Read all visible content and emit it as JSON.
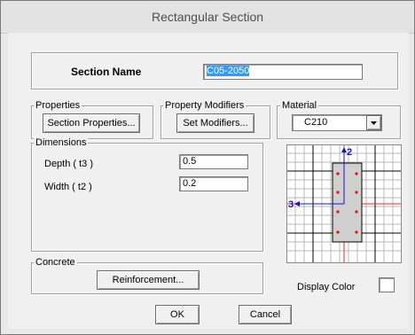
{
  "window": {
    "title": "Rectangular Section"
  },
  "section_name": {
    "label": "Section Name",
    "value": "C05-2050"
  },
  "properties": {
    "group_label": "Properties",
    "button_label": "Section Properties..."
  },
  "modifiers": {
    "group_label": "Property Modifiers",
    "button_label": "Set Modifiers..."
  },
  "material": {
    "group_label": "Material",
    "selected": "C210"
  },
  "dimensions": {
    "group_label": "Dimensions",
    "depth_label": "Depth  ( t3 )",
    "depth_value": "0.5",
    "width_label": "Width  ( t2 )",
    "width_value": "0.2"
  },
  "preview": {
    "axis_vertical_label": "2",
    "axis_horizontal_label": "3"
  },
  "concrete": {
    "group_label": "Concrete",
    "button_label": "Reinforcement..."
  },
  "display_color": {
    "label": "Display Color"
  },
  "footer": {
    "ok_label": "OK",
    "cancel_label": "Cancel"
  },
  "colors": {
    "highlight": "#3399ff",
    "rebar": "#e01010",
    "axis_red": "#ff2020",
    "axis_blue": "#1414d0"
  }
}
